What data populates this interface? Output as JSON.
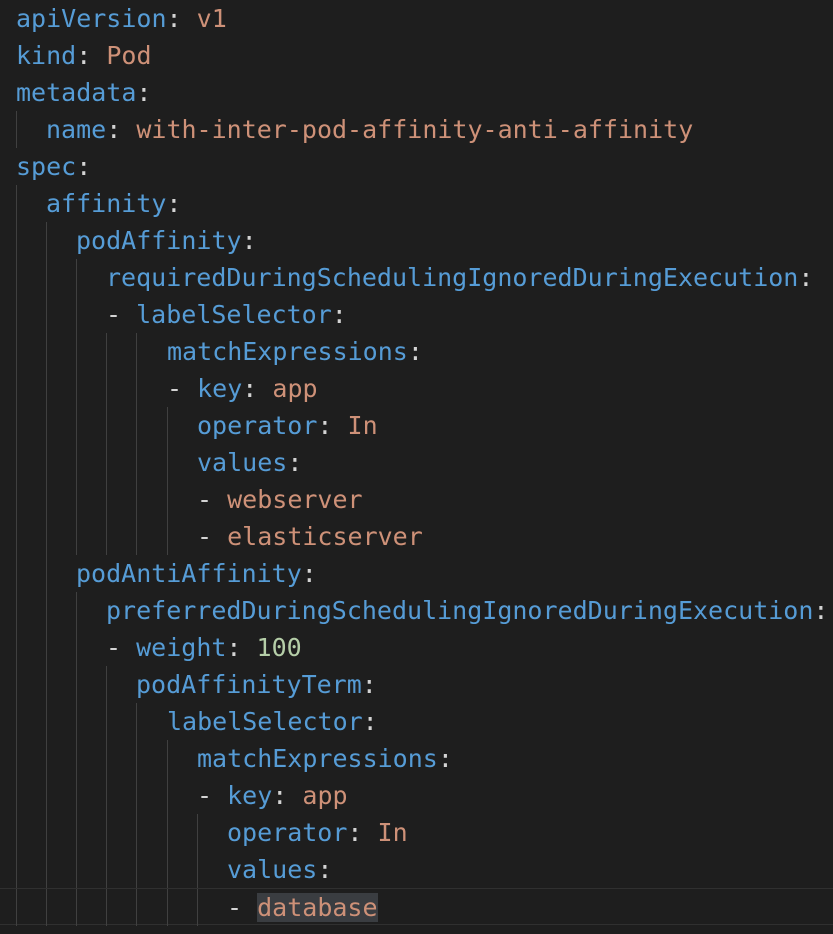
{
  "editor": {
    "language": "yaml",
    "colors": {
      "background": "#1e1e1e",
      "key": "#569cd6",
      "string": "#ce9178",
      "number": "#b5cea8",
      "punctuation": "#d4d4d4",
      "indent_guide": "#404040",
      "selection_highlight": "#3a3d41"
    },
    "lines": [
      {
        "indent": 0,
        "dash": false,
        "key": "apiVersion",
        "value": "v1",
        "vtype": "string"
      },
      {
        "indent": 0,
        "dash": false,
        "key": "kind",
        "value": "Pod",
        "vtype": "string"
      },
      {
        "indent": 0,
        "dash": false,
        "key": "metadata",
        "value": "",
        "vtype": ""
      },
      {
        "indent": 1,
        "dash": false,
        "key": "name",
        "value": "with-inter-pod-affinity-anti-affinity",
        "vtype": "string"
      },
      {
        "indent": 0,
        "dash": false,
        "key": "spec",
        "value": "",
        "vtype": ""
      },
      {
        "indent": 1,
        "dash": false,
        "key": "affinity",
        "value": "",
        "vtype": ""
      },
      {
        "indent": 2,
        "dash": false,
        "key": "podAffinity",
        "value": "",
        "vtype": ""
      },
      {
        "indent": 3,
        "dash": false,
        "key": "requiredDuringSchedulingIgnoredDuringExecution",
        "value": "",
        "vtype": ""
      },
      {
        "indent": 3,
        "dash": true,
        "key": "labelSelector",
        "value": "",
        "vtype": ""
      },
      {
        "indent": 5,
        "dash": false,
        "key": "matchExpressions",
        "value": "",
        "vtype": ""
      },
      {
        "indent": 5,
        "dash": true,
        "key": "key",
        "value": "app",
        "vtype": "string"
      },
      {
        "indent": 6,
        "dash": false,
        "key": "operator",
        "value": "In",
        "vtype": "string"
      },
      {
        "indent": 6,
        "dash": false,
        "key": "values",
        "value": "",
        "vtype": ""
      },
      {
        "indent": 6,
        "dash": true,
        "key": "",
        "value": "webserver",
        "vtype": "string"
      },
      {
        "indent": 6,
        "dash": true,
        "key": "",
        "value": "elasticserver",
        "vtype": "string"
      },
      {
        "indent": 2,
        "dash": false,
        "key": "podAntiAffinity",
        "value": "",
        "vtype": ""
      },
      {
        "indent": 3,
        "dash": false,
        "key": "preferredDuringSchedulingIgnoredDuringExecution",
        "value": "",
        "vtype": ""
      },
      {
        "indent": 3,
        "dash": true,
        "key": "weight",
        "value": "100",
        "vtype": "number"
      },
      {
        "indent": 4,
        "dash": false,
        "key": "podAffinityTerm",
        "value": "",
        "vtype": ""
      },
      {
        "indent": 5,
        "dash": false,
        "key": "labelSelector",
        "value": "",
        "vtype": ""
      },
      {
        "indent": 6,
        "dash": false,
        "key": "matchExpressions",
        "value": "",
        "vtype": ""
      },
      {
        "indent": 6,
        "dash": true,
        "key": "key",
        "value": "app",
        "vtype": "string"
      },
      {
        "indent": 7,
        "dash": false,
        "key": "operator",
        "value": "In",
        "vtype": "string"
      },
      {
        "indent": 7,
        "dash": false,
        "key": "values",
        "value": "",
        "vtype": ""
      },
      {
        "indent": 7,
        "dash": true,
        "key": "",
        "value": "database",
        "vtype": "string",
        "highlighted": true,
        "current": true
      }
    ]
  }
}
